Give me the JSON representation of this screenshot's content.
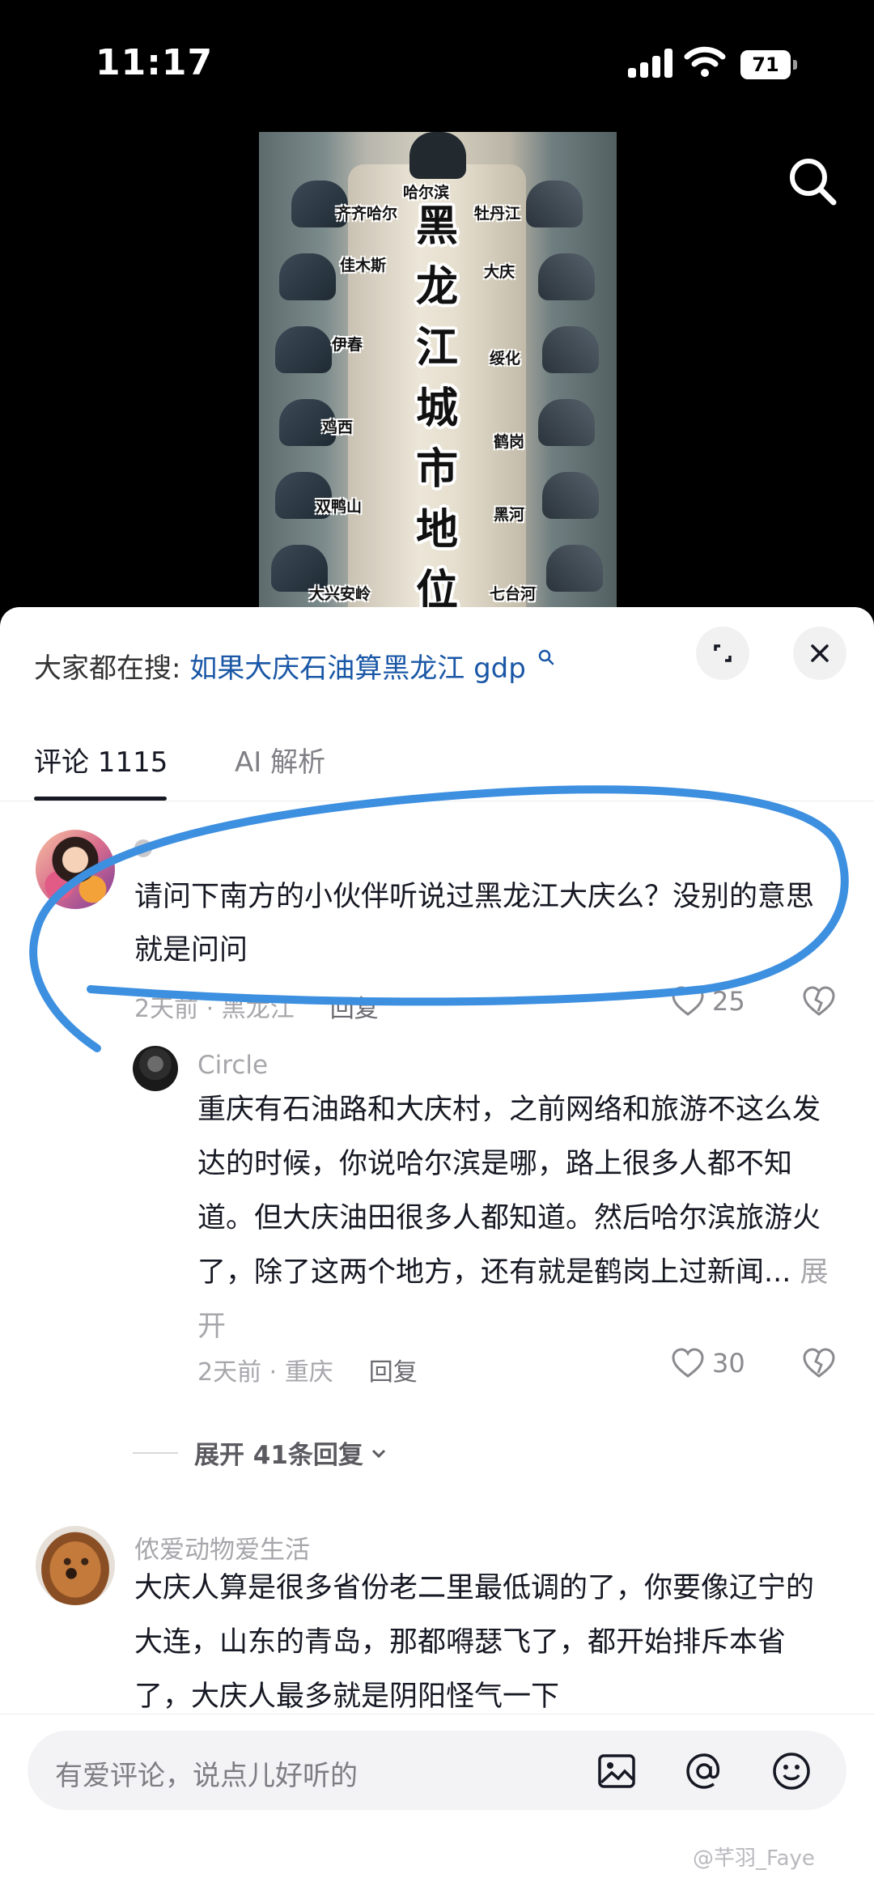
{
  "status_bar": {
    "time": "11:17",
    "battery": "71"
  },
  "video": {
    "title_chars": [
      "黑",
      "龙",
      "江",
      "城",
      "市",
      "地",
      "位"
    ],
    "cities": [
      "哈尔滨",
      "齐齐哈尔",
      "牡丹江",
      "佳木斯",
      "大庆",
      "伊春",
      "绥化",
      "鸡西",
      "鹤岗",
      "双鸭山",
      "黑河",
      "大兴安岭",
      "七台河"
    ]
  },
  "sheet": {
    "trend_prefix": "大家都在搜:",
    "trend_query": "如果大庆石油算黑龙江 gdp",
    "tabs": [
      {
        "label": "评论 1115"
      },
      {
        "label": "AI 解析"
      }
    ]
  },
  "comments": [
    {
      "text": "请问下南方的小伙伴听说过黑龙江大庆么？没别的意思就是问问",
      "meta": "2天前 · 黑龙江",
      "reply": "回复",
      "likes": "25"
    },
    {
      "author": "Circle",
      "text": "重庆有石油路和大庆村，之前网络和旅游不这么发达的时候，你说哈尔滨是哪，路上很多人都不知道。但大庆油田很多人都知道。然后哈尔滨旅游火了，除了这两个地方，还有就是鹤岗上过新闻...",
      "more": "展开",
      "meta": "2天前 · 重庆",
      "reply": "回复",
      "likes": "30",
      "expand_replies": "展开 41条回复"
    },
    {
      "author": "侬爱动物爱生活",
      "text": "大庆人算是很多省份老二里最低调的了，你要像辽宁的大连，山东的青岛，那都嘚瑟飞了，都开始排斥本省了，大庆人最多就是阴阳怪气一下"
    }
  ],
  "input": {
    "placeholder": "有爱评论，说点儿好听的"
  },
  "watermark": "@芊羽_Faye",
  "annotation_color": "#3d8fe0"
}
